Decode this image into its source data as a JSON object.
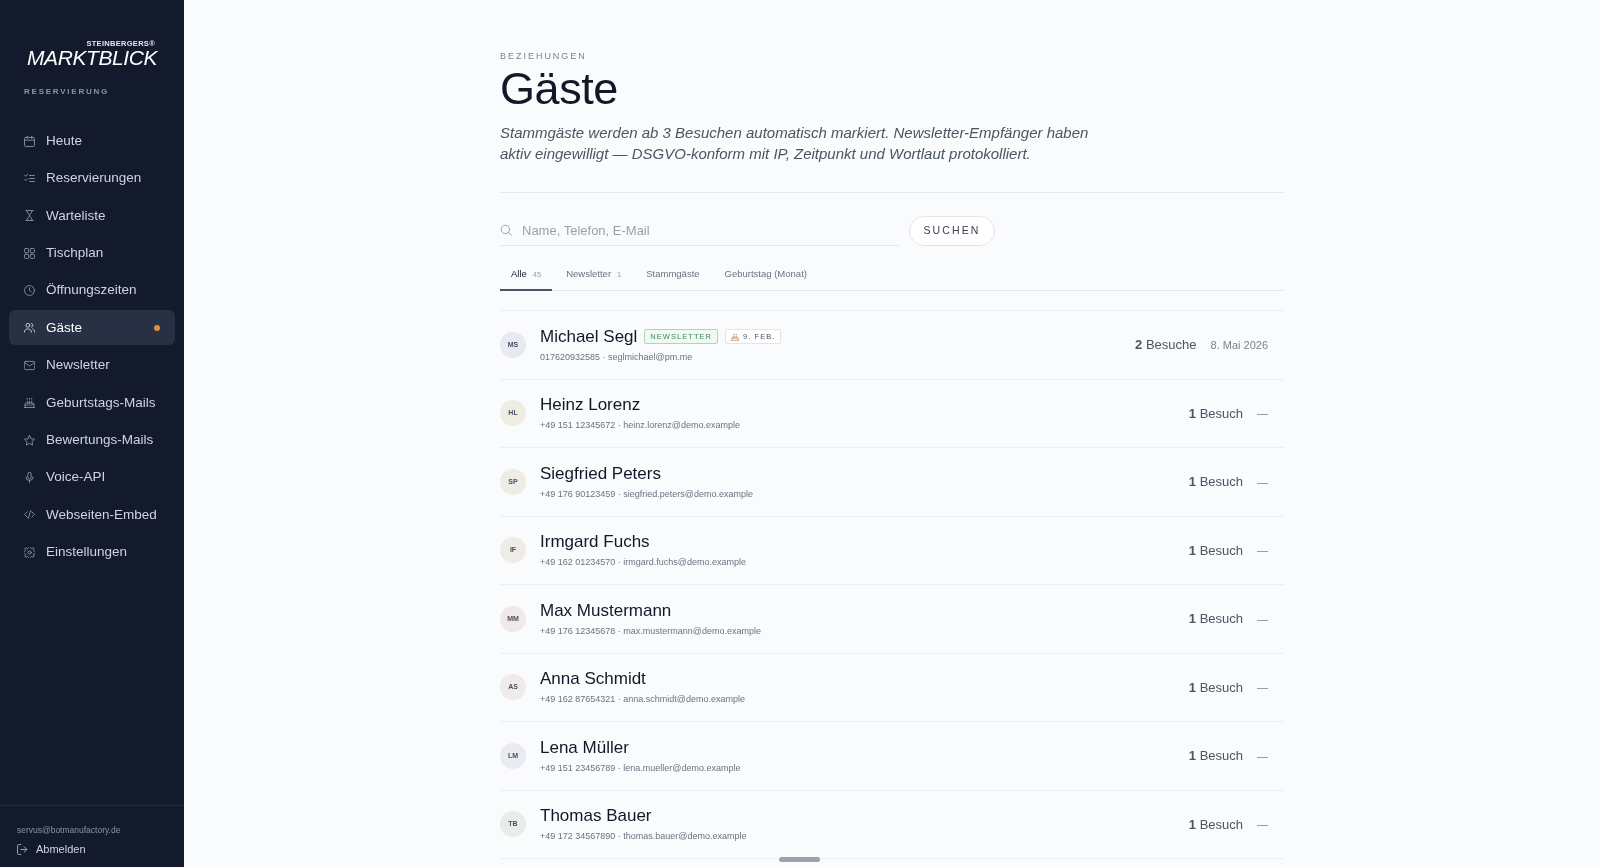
{
  "sidebar": {
    "logo": {
      "tagline": "STEINBERGERS®",
      "wordmark": "MARKTBLICK"
    },
    "section_label": "RESERVIERUNG",
    "items": [
      {
        "label": "Heute",
        "selected": false,
        "unread": false
      },
      {
        "label": "Reservierungen",
        "selected": false,
        "unread": false
      },
      {
        "label": "Warteliste",
        "selected": false,
        "unread": false
      },
      {
        "label": "Tischplan",
        "selected": false,
        "unread": false
      },
      {
        "label": "Öffnungszeiten",
        "selected": false,
        "unread": false
      },
      {
        "label": "Gäste",
        "selected": true,
        "unread": true
      },
      {
        "label": "Newsletter",
        "selected": false,
        "unread": false
      },
      {
        "label": "Geburtstags-Mails",
        "selected": false,
        "unread": false
      },
      {
        "label": "Bewertungs-Mails",
        "selected": false,
        "unread": false
      },
      {
        "label": "Voice-API",
        "selected": false,
        "unread": false
      },
      {
        "label": "Webseiten-Embed",
        "selected": false,
        "unread": false
      },
      {
        "label": "Einstellungen",
        "selected": false,
        "unread": false
      }
    ],
    "account_email": "servus@botmanufactory.de",
    "logout_label": "Abmelden"
  },
  "page": {
    "eyebrow": "BEZIEHUNGEN",
    "title": "Gäste",
    "description": "Stammgäste werden ab 3 Besuchen automatisch markiert. Newsletter-Empfänger haben aktiv eingewilligt — DSGVO-konform mit IP, Zeitpunkt und Wortlaut protokolliert.",
    "search": {
      "placeholder": "Name, Telefon, E-Mail",
      "button": "SUCHEN"
    },
    "tabs": [
      {
        "label": "Alle",
        "count": "45",
        "selected": true
      },
      {
        "label": "Newsletter",
        "count": "1",
        "selected": false
      },
      {
        "label": "Stammgäste",
        "selected": false
      },
      {
        "label": "Geburtstag (Monat)",
        "selected": false
      }
    ],
    "guests": [
      {
        "initials": "MS",
        "color": "#e9e9f1",
        "name": "Michael Segl",
        "badges": [
          {
            "kind": "newsletter",
            "label": "NEWSLETTER"
          },
          {
            "kind": "birthday",
            "label": "9. FEB."
          }
        ],
        "contact": "017620932585 · seglmichael@pm.me",
        "visits": "**2** Besuche",
        "last_visit": "8. Mai 2026"
      },
      {
        "initials": "HL",
        "color": "#efede3",
        "name": "Heinz Lorenz",
        "contact": "+49 151 12345672 · heinz.lorenz@demo.example",
        "visits": "**1** Besuch",
        "last_visit": "—"
      },
      {
        "initials": "SP",
        "color": "#eeece5",
        "name": "Siegfried Peters",
        "contact": "+49 176 90123459 · siegfried.peters@demo.example",
        "visits": "**1** Besuch",
        "last_visit": "—"
      },
      {
        "initials": "IF",
        "color": "#efebe7",
        "name": "Irmgard Fuchs",
        "contact": "+49 162 01234570 · irmgard.fuchs@demo.example",
        "visits": "**1** Besuch",
        "last_visit": "—"
      },
      {
        "initials": "MM",
        "color": "#f1e9e9",
        "name": "Max Mustermann",
        "contact": "+49 176 12345678 · max.mustermann@demo.example",
        "visits": "**1** Besuch",
        "last_visit": "—"
      },
      {
        "initials": "AS",
        "color": "#f1eaea",
        "name": "Anna Schmidt",
        "contact": "+49 162 87654321 · anna.schmidt@demo.example",
        "visits": "**1** Besuch",
        "last_visit": "—"
      },
      {
        "initials": "LM",
        "color": "#eaeaf1",
        "name": "Lena Müller",
        "contact": "+49 151 23456789 · lena.mueller@demo.example",
        "visits": "**1** Besuch",
        "last_visit": "—"
      },
      {
        "initials": "TB",
        "color": "#e7edea",
        "name": "Thomas Bauer",
        "contact": "+49 172 34567890 · thomas.bauer@demo.example",
        "visits": "**1** Besuch",
        "last_visit": "—"
      }
    ]
  }
}
